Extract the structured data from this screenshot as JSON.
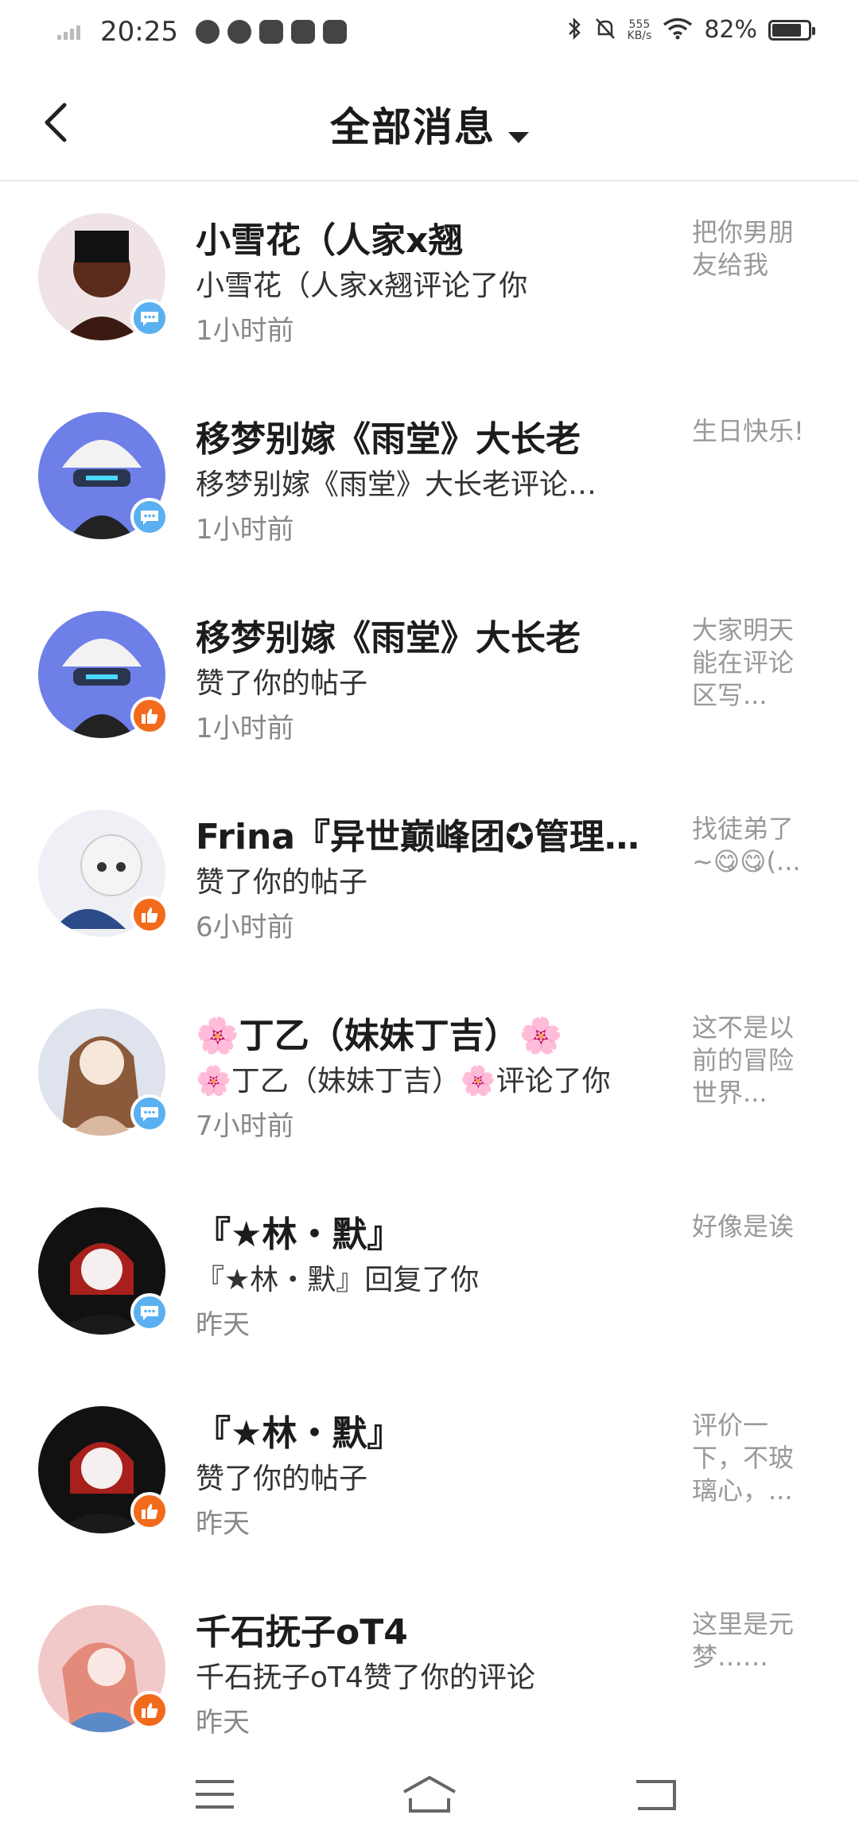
{
  "status_bar": {
    "time": "20:25",
    "net_speed_value": "555",
    "net_speed_unit": "KB/s",
    "battery_text": "82%",
    "battery_level": 0.82
  },
  "header": {
    "title": "全部消息"
  },
  "messages": [
    {
      "name": "小雪花（人家x翘",
      "action": "小雪花（人家x翘评论了你",
      "time": "1小时前",
      "preview": "把你男朋友给我",
      "badge": "comment-icon"
    },
    {
      "name": "移梦别嫁《雨堂》大长老",
      "action": "移梦别嫁《雨堂》大长老评论…",
      "time": "1小时前",
      "preview": "生日快乐!",
      "badge": "comment-icon"
    },
    {
      "name": "移梦别嫁《雨堂》大长老",
      "action": "赞了你的帖子",
      "time": "1小时前",
      "preview": "大家明天能在评论区写...",
      "badge": "like-icon"
    },
    {
      "name": "Frina『异世巅峰团✪管理…",
      "action": "赞了你的帖子",
      "time": "6小时前",
      "preview": "找徒弟了~😋😋(...",
      "badge": "like-icon"
    },
    {
      "name": "🌸丁乙（妹妹丁吉）🌸",
      "action": "🌸丁乙（妹妹丁吉）🌸评论了你",
      "time": "7小时前",
      "preview": "这不是以前的冒险世界...",
      "badge": "comment-icon"
    },
    {
      "name": "『★林・默』",
      "action": "『★林・默』回复了你",
      "time": "昨天",
      "preview": "好像是诶",
      "badge": "comment-icon"
    },
    {
      "name": "『★林・默』",
      "action": "赞了你的帖子",
      "time": "昨天",
      "preview": "评价一下，不玻璃心，...",
      "badge": "like-icon"
    },
    {
      "name": "千石抚子oT4",
      "action": "千石抚子oT4赞了你的评论",
      "time": "昨天",
      "preview": "这里是元梦……",
      "badge": "like-icon"
    }
  ],
  "colors": {
    "comment_badge": "#5ab0f0",
    "like_badge": "#f26a1b",
    "preview_text": "#999999",
    "time_text": "#888888"
  }
}
